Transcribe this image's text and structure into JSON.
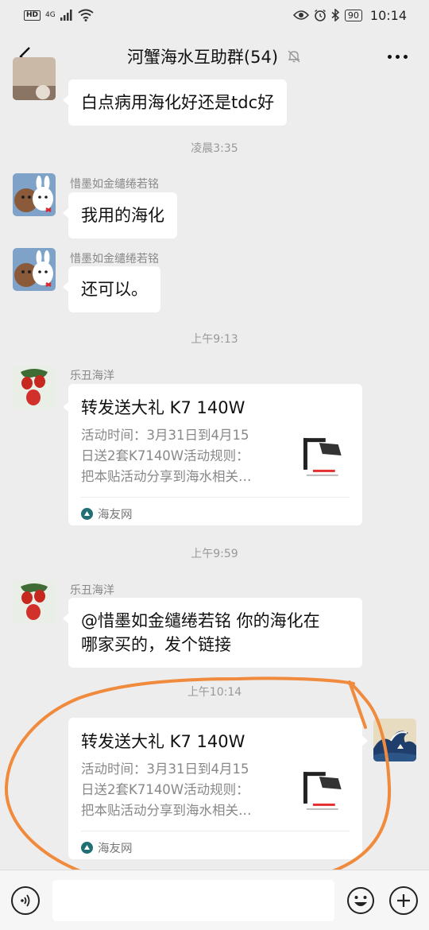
{
  "status_bar": {
    "hd": "HD",
    "signal": "4G",
    "battery": "90",
    "time": "10:14"
  },
  "header": {
    "title": "河蟹海水互助群(54)"
  },
  "messages": [
    {
      "text": "白点病用海化好还是tdc好"
    },
    {
      "timestamp": "凌晨3:35"
    },
    {
      "sender": "惜墨如金缱绻若铭",
      "text": "我用的海化"
    },
    {
      "sender": "惜墨如金缱绻若铭",
      "text": "还可以。"
    },
    {
      "timestamp": "上午9:13"
    },
    {
      "sender": "乐丑海洋",
      "card": {
        "title": "转发送大礼 K7 140W",
        "desc_lines": [
          "活动时间：3月31日到4月15",
          "日送2套K7140W活动规则：",
          "把本贴活动分享到海水相关…"
        ],
        "source": "海友网"
      }
    },
    {
      "timestamp": "上午9:59"
    },
    {
      "sender": "乐丑海洋",
      "text_lines": [
        "@惜墨如金缱绻若铭  你的海化在",
        "哪家买的，发个链接"
      ]
    },
    {
      "timestamp": "上午10:14"
    },
    {
      "sender": "self",
      "card": {
        "title": "转发送大礼 K7 140W",
        "desc_lines": [
          "活动时间：3月31日到4月15",
          "日送2套K7140W活动规则：",
          "把本贴活动分享到海水相关…"
        ],
        "source": "海友网"
      }
    }
  ],
  "colors": {
    "background": "#ededed",
    "bubble": "#ffffff",
    "annotation": "#f08a3c"
  }
}
